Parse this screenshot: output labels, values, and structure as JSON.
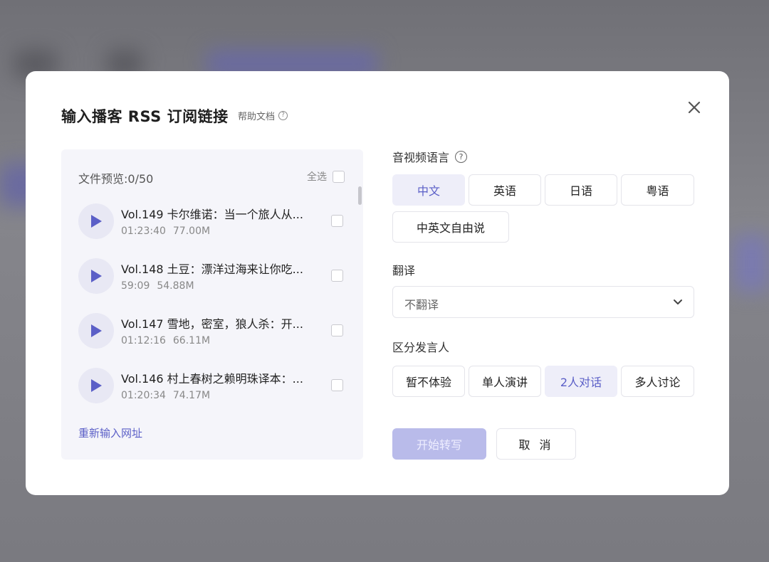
{
  "modal": {
    "title": "输入播客 RSS 订阅链接",
    "help_label": "帮助文档",
    "close_icon": "close-icon"
  },
  "preview": {
    "label": "文件预览:0/50",
    "select_all": "全选",
    "episodes": [
      {
        "title": "Vol.149 卡尔维诺：当一个旅人从...",
        "duration": "01:23:40",
        "size": "77.00M"
      },
      {
        "title": "Vol.148 土豆：漂洋过海来让你吃...",
        "duration": "59:09",
        "size": "54.88M"
      },
      {
        "title": "Vol.147 雪地，密室，狼人杀：开...",
        "duration": "01:12:16",
        "size": "66.11M"
      },
      {
        "title": "Vol.146 村上春树之赖明珠译本：...",
        "duration": "01:20:34",
        "size": "74.17M"
      }
    ],
    "reenter_label": "重新输入网址"
  },
  "language": {
    "label": "音视频语言",
    "options": [
      "中文",
      "英语",
      "日语",
      "粤语",
      "中英文自由说"
    ],
    "selected": "中文"
  },
  "translate": {
    "label": "翻译",
    "value": "不翻译"
  },
  "speakers": {
    "label": "区分发言人",
    "options": [
      "暂不体验",
      "单人演讲",
      "2人对话",
      "多人讨论"
    ],
    "selected": "2人对话"
  },
  "actions": {
    "start": "开始转写",
    "cancel": "取 消"
  },
  "colors": {
    "accent": "#5b5fc7",
    "accent_soft": "#eeeef9",
    "start_disabled": "#b9bbea"
  }
}
